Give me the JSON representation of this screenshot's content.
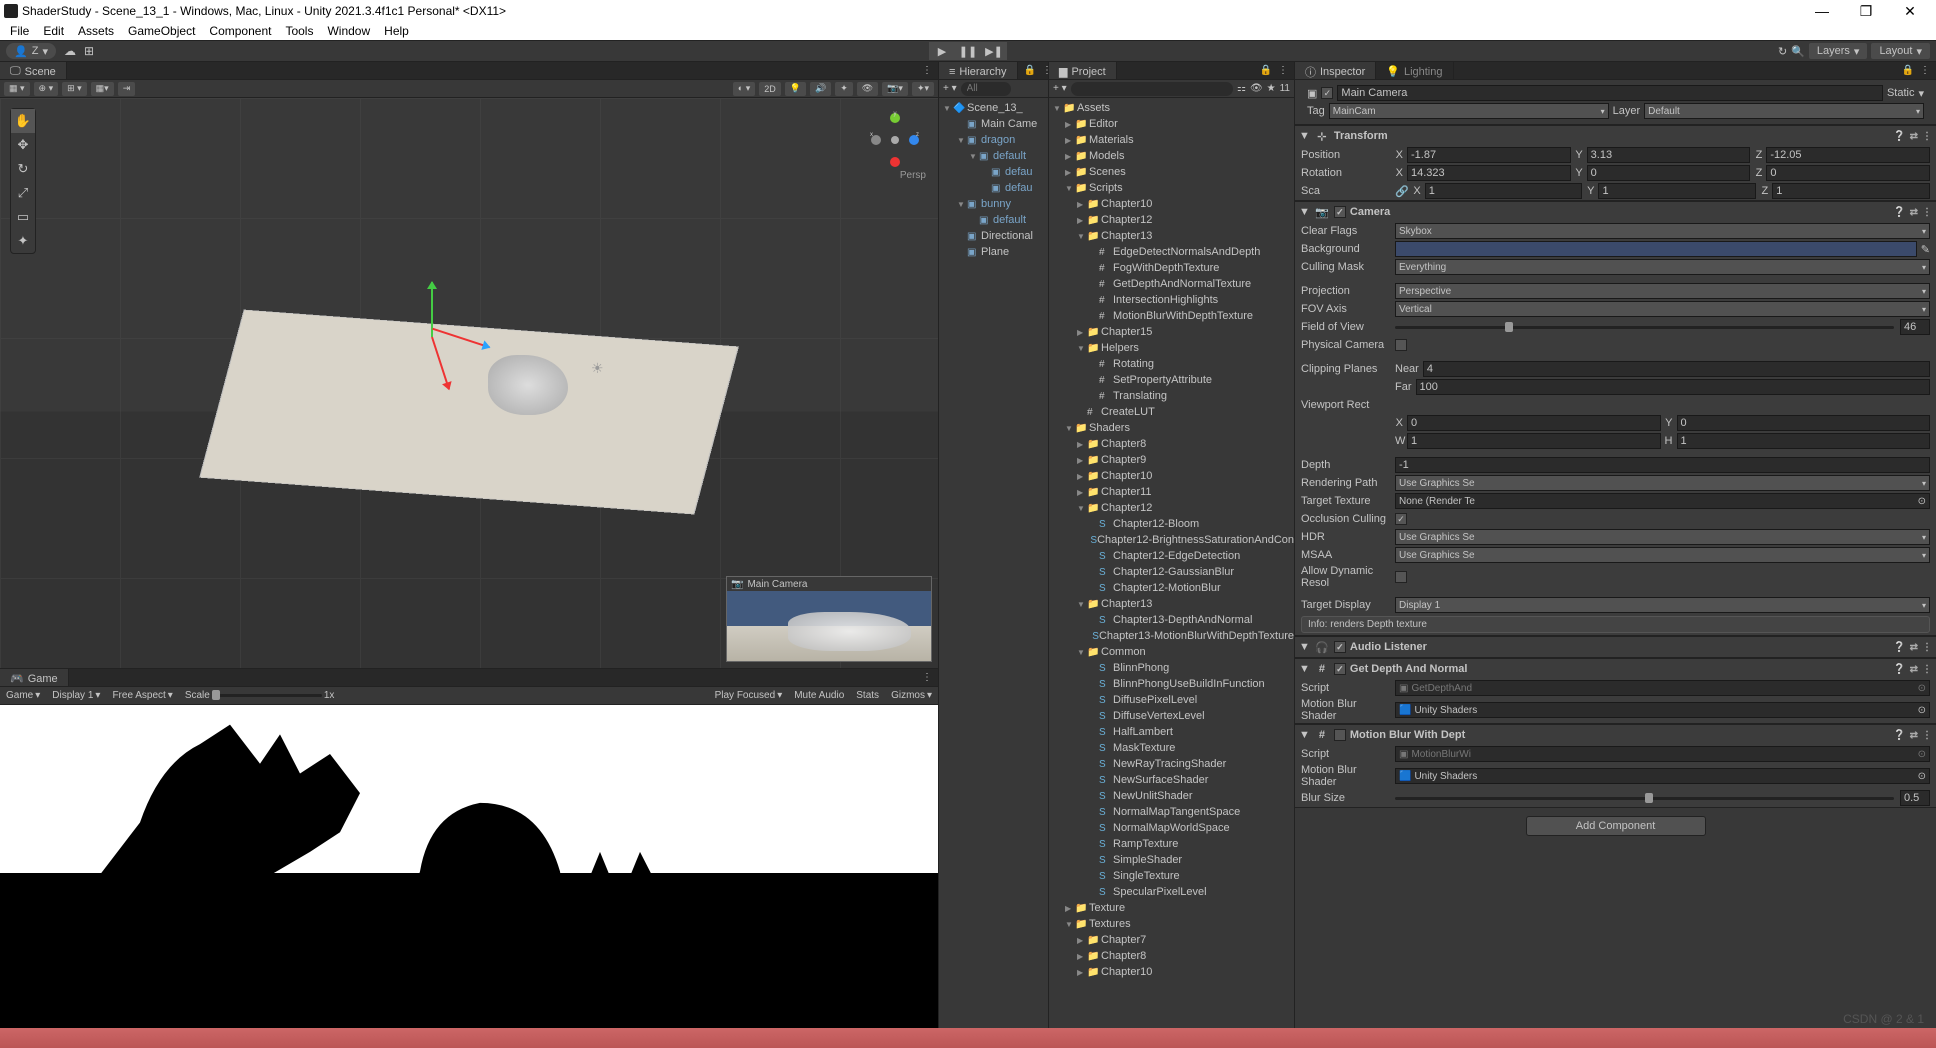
{
  "titlebar": {
    "title": "ShaderStudy - Scene_13_1 - Windows, Mac, Linux - Unity 2021.3.4f1c1 Personal* <DX11>"
  },
  "menus": [
    "File",
    "Edit",
    "Assets",
    "GameObject",
    "Component",
    "Tools",
    "Window",
    "Help"
  ],
  "toolbar": {
    "account": "Z",
    "layers": "Layers",
    "layout": "Layout"
  },
  "scene_tab": "Scene",
  "persp_label": "Persp",
  "cam_preview_label": "Main Camera",
  "game_tab": "Game",
  "game_bar": {
    "game": "Game",
    "display": "Display 1",
    "aspect": "Free Aspect",
    "scale_lbl": "Scale",
    "scale_val": "1x",
    "play_focused": "Play Focused",
    "mute": "Mute Audio",
    "stats": "Stats",
    "gizmos": "Gizmos"
  },
  "hierarchy": {
    "tab": "Hierarchy",
    "search_ph": "All",
    "scene": "Scene_13_",
    "items": [
      {
        "name": "Main Came",
        "d": 1
      },
      {
        "name": "dragon",
        "d": 1,
        "blue": true,
        "arrow": "▼"
      },
      {
        "name": "default",
        "d": 2,
        "blue": true,
        "arrow": "▼"
      },
      {
        "name": "defau",
        "d": 3,
        "blue": true
      },
      {
        "name": "defau",
        "d": 3,
        "blue": true
      },
      {
        "name": "bunny",
        "d": 1,
        "blue": true,
        "arrow": "▼"
      },
      {
        "name": "default",
        "d": 2,
        "blue": true
      },
      {
        "name": "Directional",
        "d": 1
      },
      {
        "name": "Plane",
        "d": 1
      }
    ]
  },
  "project": {
    "tab": "Project",
    "search_ph": "",
    "fav_count": "11",
    "tree": [
      {
        "n": "Assets",
        "d": 0,
        "a": "▼",
        "t": "f"
      },
      {
        "n": "Editor",
        "d": 1,
        "a": "▶",
        "t": "f"
      },
      {
        "n": "Materials",
        "d": 1,
        "a": "▶",
        "t": "f"
      },
      {
        "n": "Models",
        "d": 1,
        "a": "▶",
        "t": "f"
      },
      {
        "n": "Scenes",
        "d": 1,
        "a": "▶",
        "t": "f"
      },
      {
        "n": "Scripts",
        "d": 1,
        "a": "▼",
        "t": "f"
      },
      {
        "n": "Chapter10",
        "d": 2,
        "a": "▶",
        "t": "f"
      },
      {
        "n": "Chapter12",
        "d": 2,
        "a": "▶",
        "t": "f"
      },
      {
        "n": "Chapter13",
        "d": 2,
        "a": "▼",
        "t": "f"
      },
      {
        "n": "EdgeDetectNormalsAndDepth",
        "d": 3,
        "t": "s"
      },
      {
        "n": "FogWithDepthTexture",
        "d": 3,
        "t": "s"
      },
      {
        "n": "GetDepthAndNormalTexture",
        "d": 3,
        "t": "s"
      },
      {
        "n": "IntersectionHighlights",
        "d": 3,
        "t": "s"
      },
      {
        "n": "MotionBlurWithDepthTexture",
        "d": 3,
        "t": "s"
      },
      {
        "n": "Chapter15",
        "d": 2,
        "a": "▶",
        "t": "f"
      },
      {
        "n": "Helpers",
        "d": 2,
        "a": "▼",
        "t": "f"
      },
      {
        "n": "Rotating",
        "d": 3,
        "t": "s"
      },
      {
        "n": "SetPropertyAttribute",
        "d": 3,
        "t": "s"
      },
      {
        "n": "Translating",
        "d": 3,
        "t": "s"
      },
      {
        "n": "CreateLUT",
        "d": 2,
        "t": "s"
      },
      {
        "n": "Shaders",
        "d": 1,
        "a": "▼",
        "t": "f"
      },
      {
        "n": "Chapter8",
        "d": 2,
        "a": "▶",
        "t": "f"
      },
      {
        "n": "Chapter9",
        "d": 2,
        "a": "▶",
        "t": "f"
      },
      {
        "n": "Chapter10",
        "d": 2,
        "a": "▶",
        "t": "f"
      },
      {
        "n": "Chapter11",
        "d": 2,
        "a": "▶",
        "t": "f"
      },
      {
        "n": "Chapter12",
        "d": 2,
        "a": "▼",
        "t": "f"
      },
      {
        "n": "Chapter12-Bloom",
        "d": 3,
        "t": "sh"
      },
      {
        "n": "Chapter12-BrightnessSaturationAndCon",
        "d": 3,
        "t": "sh"
      },
      {
        "n": "Chapter12-EdgeDetection",
        "d": 3,
        "t": "sh"
      },
      {
        "n": "Chapter12-GaussianBlur",
        "d": 3,
        "t": "sh"
      },
      {
        "n": "Chapter12-MotionBlur",
        "d": 3,
        "t": "sh"
      },
      {
        "n": "Chapter13",
        "d": 2,
        "a": "▼",
        "t": "f"
      },
      {
        "n": "Chapter13-DepthAndNormal",
        "d": 3,
        "t": "sh"
      },
      {
        "n": "Chapter13-MotionBlurWithDepthTexture",
        "d": 3,
        "t": "sh"
      },
      {
        "n": "Common",
        "d": 2,
        "a": "▼",
        "t": "f"
      },
      {
        "n": "BlinnPhong",
        "d": 3,
        "t": "sh"
      },
      {
        "n": "BlinnPhongUseBuildInFunction",
        "d": 3,
        "t": "sh"
      },
      {
        "n": "DiffusePixelLevel",
        "d": 3,
        "t": "sh"
      },
      {
        "n": "DiffuseVertexLevel",
        "d": 3,
        "t": "sh"
      },
      {
        "n": "HalfLambert",
        "d": 3,
        "t": "sh"
      },
      {
        "n": "MaskTexture",
        "d": 3,
        "t": "sh"
      },
      {
        "n": "NewRayTracingShader",
        "d": 3,
        "t": "sh"
      },
      {
        "n": "NewSurfaceShader",
        "d": 3,
        "t": "sh"
      },
      {
        "n": "NewUnlitShader",
        "d": 3,
        "t": "sh"
      },
      {
        "n": "NormalMapTangentSpace",
        "d": 3,
        "t": "sh"
      },
      {
        "n": "NormalMapWorldSpace",
        "d": 3,
        "t": "sh"
      },
      {
        "n": "RampTexture",
        "d": 3,
        "t": "sh"
      },
      {
        "n": "SimpleShader",
        "d": 3,
        "t": "sh"
      },
      {
        "n": "SingleTexture",
        "d": 3,
        "t": "sh"
      },
      {
        "n": "SpecularPixelLevel",
        "d": 3,
        "t": "sh"
      },
      {
        "n": "Texture",
        "d": 1,
        "a": "▶",
        "t": "f"
      },
      {
        "n": "Textures",
        "d": 1,
        "a": "▼",
        "t": "f"
      },
      {
        "n": "Chapter7",
        "d": 2,
        "a": "▶",
        "t": "f"
      },
      {
        "n": "Chapter8",
        "d": 2,
        "a": "▶",
        "t": "f"
      },
      {
        "n": "Chapter10",
        "d": 2,
        "a": "▶",
        "t": "f"
      }
    ]
  },
  "inspector": {
    "tab": "Inspector",
    "tab2": "Lighting",
    "obj_name": "Main Camera",
    "static": "Static",
    "tag_lbl": "Tag",
    "tag": "MainCam",
    "layer_lbl": "Layer",
    "layer": "Default",
    "transform": {
      "title": "Transform",
      "px": "-1.87",
      "py": "3.13",
      "pz": "-12.05",
      "rx": "14.323",
      "ry": "0",
      "rz": "0",
      "sx": "1",
      "sy": "1",
      "sz": "1",
      "pos": "Position",
      "rot": "Rotation",
      "sca": "Sca"
    },
    "camera": {
      "title": "Camera",
      "clear_flags_l": "Clear Flags",
      "clear_flags": "Skybox",
      "background_l": "Background",
      "bg_color": "#3b4a6b",
      "culling_l": "Culling Mask",
      "culling": "Everything",
      "projection_l": "Projection",
      "projection": "Perspective",
      "fov_axis_l": "FOV Axis",
      "fov_axis": "Vertical",
      "fov_l": "Field of View",
      "fov": "46",
      "physical_l": "Physical Camera",
      "clip_l": "Clipping Planes",
      "near_l": "Near",
      "near": "4",
      "far_l": "Far",
      "far": "100",
      "viewport_l": "Viewport Rect",
      "vx": "0",
      "vy": "0",
      "vw": "1",
      "vh": "1",
      "depth_l": "Depth",
      "depth": "-1",
      "rendpath_l": "Rendering Path",
      "rendpath": "Use Graphics Se",
      "target_tex_l": "Target Texture",
      "target_tex": "None (Render Te",
      "occ_l": "Occlusion Culling",
      "hdr_l": "HDR",
      "hdr": "Use Graphics Se",
      "msaa_l": "MSAA",
      "msaa": "Use Graphics Se",
      "dyn_l": "Allow Dynamic Resol",
      "tdisp_l": "Target Display",
      "tdisp": "Display 1",
      "info": "Info: renders Depth texture"
    },
    "audio": {
      "title": "Audio Listener"
    },
    "getdepth": {
      "title": "Get Depth And Normal",
      "script_l": "Script",
      "script": "GetDepthAnd",
      "shader_l": "Motion Blur Shader",
      "shader": "Unity Shaders"
    },
    "motionblur": {
      "title": "Motion Blur With Dept",
      "script_l": "Script",
      "script": "MotionBlurWi",
      "shader_l": "Motion Blur Shader",
      "shader": "Unity Shaders",
      "blur_l": "Blur Size",
      "blur": "0.5"
    },
    "add_comp": "Add Component"
  },
  "watermark": "CSDN @ 2 & 1"
}
